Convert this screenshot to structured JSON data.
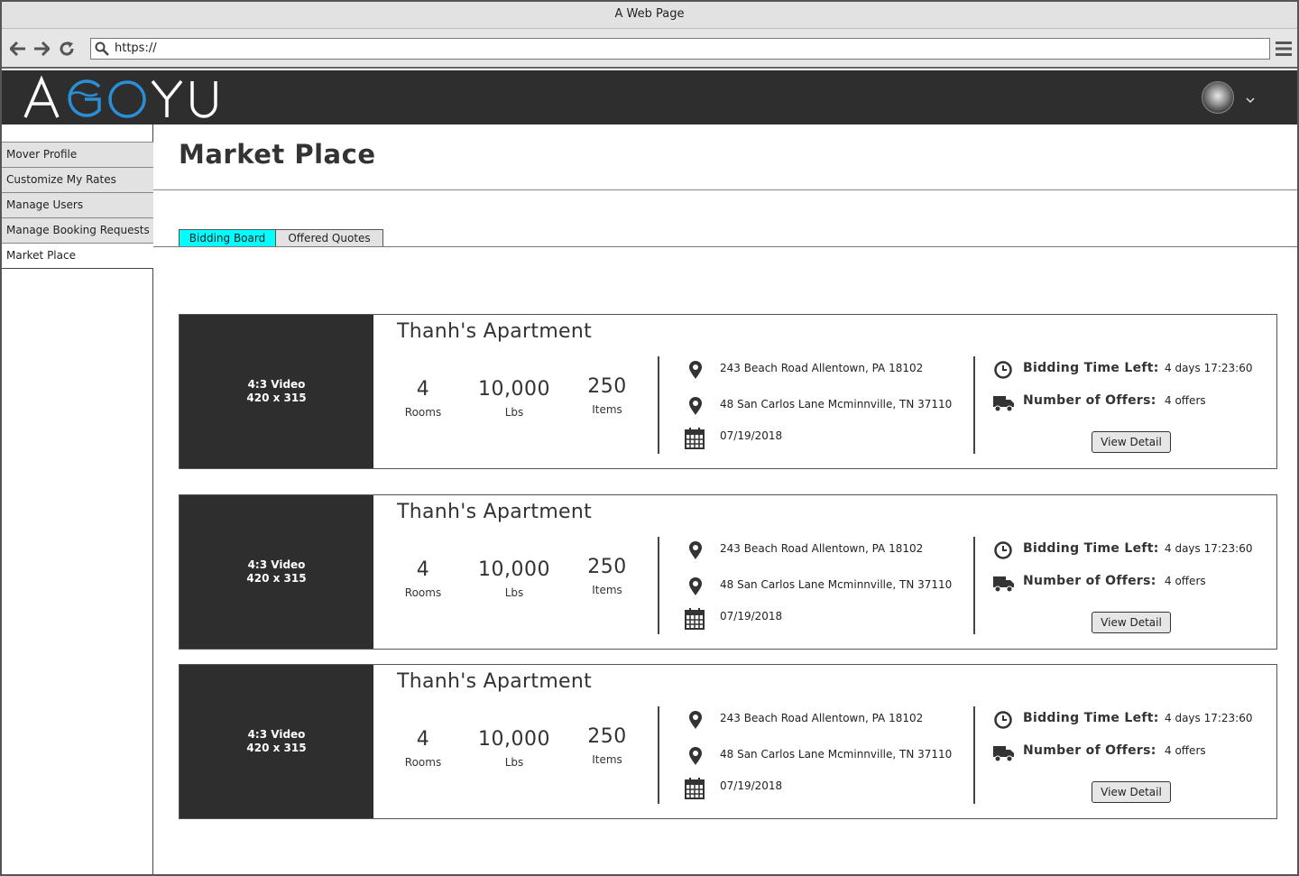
{
  "browser": {
    "title": "A Web Page",
    "url": "https://"
  },
  "header": {
    "logo_text": "AGOYU"
  },
  "sidebar": {
    "items": [
      {
        "label": "Mover Profile"
      },
      {
        "label": "Customize My Rates"
      },
      {
        "label": "Manage Users"
      },
      {
        "label": "Manage Booking Requests"
      },
      {
        "label": "Market Place"
      }
    ]
  },
  "main": {
    "title": "Market Place",
    "tabs": [
      {
        "label": "Bidding Board",
        "active": true
      },
      {
        "label": "Offered Quotes",
        "active": false
      }
    ],
    "accent_color": "#00ffff"
  },
  "cards": [
    {
      "video_line1": "4:3 Video",
      "video_line2": "420 x 315",
      "title": "Thanh's Apartment",
      "rooms": "4",
      "rooms_label": "Rooms",
      "lbs": "10,000",
      "lbs_label": "Lbs",
      "items": "250",
      "items_label": "Items",
      "from": "243 Beach Road Allentown, PA 18102",
      "to": "48 San Carlos Lane Mcminnville, TN 37110",
      "date": "07/19/2018",
      "time_left_label": "Bidding Time Left:",
      "time_left": "4 days 17:23:60",
      "offers_label": "Number of Offers:",
      "offers": "4 offers",
      "button": "View Detail"
    },
    {
      "video_line1": "4:3 Video",
      "video_line2": "420 x 315",
      "title": "Thanh's Apartment",
      "rooms": "4",
      "rooms_label": "Rooms",
      "lbs": "10,000",
      "lbs_label": "Lbs",
      "items": "250",
      "items_label": "Items",
      "from": "243 Beach Road Allentown, PA 18102",
      "to": "48 San Carlos Lane Mcminnville, TN 37110",
      "date": "07/19/2018",
      "time_left_label": "Bidding Time Left:",
      "time_left": "4 days 17:23:60",
      "offers_label": "Number of Offers:",
      "offers": "4 offers",
      "button": "View Detail"
    },
    {
      "video_line1": "4:3 Video",
      "video_line2": "420 x 315",
      "title": "Thanh's Apartment",
      "rooms": "4",
      "rooms_label": "Rooms",
      "lbs": "10,000",
      "lbs_label": "Lbs",
      "items": "250",
      "items_label": "Items",
      "from": "243 Beach Road Allentown, PA 18102",
      "to": "48 San Carlos Lane Mcminnville, TN 37110",
      "date": "07/19/2018",
      "time_left_label": "Bidding Time Left:",
      "time_left": "4 days 17:23:60",
      "offers_label": "Number of Offers:",
      "offers": "4 offers",
      "button": "View Detail"
    }
  ]
}
